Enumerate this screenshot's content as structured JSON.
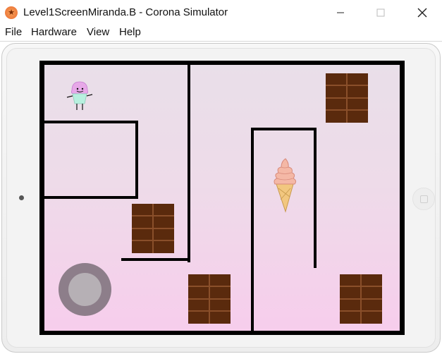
{
  "window": {
    "title": "Level1ScreenMiranda.B - Corona Simulator",
    "app_icon": "corona-simulator-icon"
  },
  "menu": {
    "items": [
      "File",
      "Hardware",
      "View",
      "Help"
    ]
  },
  "game": {
    "player_icon": "cupcake-character-icon",
    "goal_icon": "ice-cream-cone-icon",
    "obstacle_icon": "chocolate-bar-icon",
    "joystick_icon": "joystick-icon",
    "colors": {
      "background_top": "#e9dfe9",
      "background_bottom": "#f7cdec",
      "walls": "#000000",
      "chocolate": "#5a2a0d",
      "joystick": "#8d7e8a"
    }
  }
}
